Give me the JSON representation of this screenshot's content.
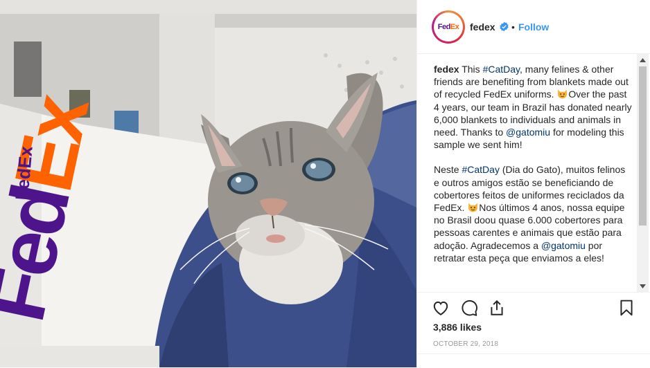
{
  "post": {
    "username": "fedex",
    "separator": "•",
    "follow_label": "Follow",
    "avatar_text_fed": "Fed",
    "avatar_text_ex": "Ex",
    "photo_box_text": "FedEx",
    "caption": {
      "p1_user": "fedex",
      "p1_a": " This ",
      "p1_tag1": "#CatDay",
      "p1_b": ", many felines & other friends are benefiting from blankets made out of recycled FedEx uniforms. ",
      "p1_c": "Over the past 4 years, our team in Brazil has donated nearly 6,000 blankets to individuals and animals in need. Thanks to ",
      "p1_mention": "@gatomiu",
      "p1_d": " for modeling this sample we sent him!",
      "p2_a": "Neste ",
      "p2_tag": "#CatDay",
      "p2_b": " (Dia do Gato), muitos felinos e outros amigos estão se beneficiando de cobertores feitos de uniformes reciclados da FedEx. ",
      "p2_c": "Nos últimos 4 anos, nossa equipe no Brasil doou quase 6.000 cobertores para pessoas carentes e animais que estão para adoção. Agradecemos a ",
      "p2_mention": "@gatomiu",
      "p2_d": " por retratar esta peça que enviamos a eles!"
    },
    "likes": "3,886 likes",
    "date": "October 29, 2018"
  },
  "icons": {
    "verified": "verified-badge-icon",
    "like": "heart-icon",
    "comment": "comment-icon",
    "share": "share-icon",
    "save": "bookmark-icon",
    "emoji": "cat-face-emoji-icon"
  },
  "colors": {
    "link": "#3897f0",
    "hashtag": "#003569",
    "fedex_purple": "#4d148c",
    "fedex_orange": "#ff6200"
  }
}
